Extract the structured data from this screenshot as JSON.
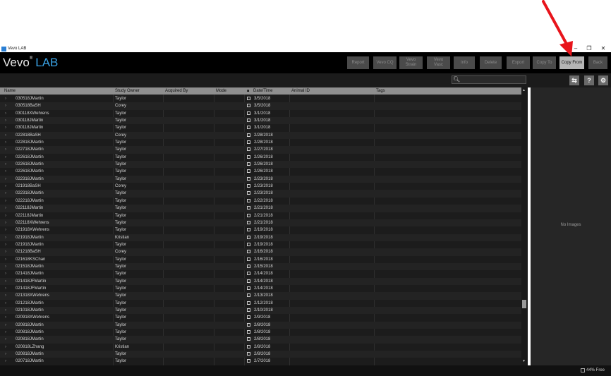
{
  "window": {
    "title": "Vevo LAB",
    "controls": {
      "minimize": "–",
      "maximize": "❐",
      "close": "✕"
    }
  },
  "logo": {
    "vevo": "Vevo",
    "reg": "®",
    "lab": "LAB"
  },
  "toolbar_buttons": [
    {
      "label": "Report",
      "active": false
    },
    {
      "label": "Vevo CQ",
      "active": false
    },
    {
      "label": "Vevo\nStrain",
      "active": false
    },
    {
      "label": "Vevo\nVasc",
      "active": false
    },
    {
      "label": "Info",
      "active": false
    },
    {
      "label": "Delete",
      "active": false
    },
    {
      "label": "Export",
      "active": false
    },
    {
      "label": "Copy To",
      "active": false
    },
    {
      "label": "Copy From",
      "active": true
    },
    {
      "label": "Back",
      "active": false
    }
  ],
  "search": {
    "placeholder": "",
    "icon": "search-icon"
  },
  "icon_buttons": [
    {
      "icon": "refresh-icon",
      "glyph": "⇆"
    },
    {
      "icon": "help-icon",
      "glyph": "?"
    },
    {
      "icon": "gear-icon",
      "glyph": "⚙"
    }
  ],
  "table": {
    "columns": [
      "Name",
      "Study Owner",
      "Acquired By",
      "Mode",
      "Date/Time",
      "Animal ID",
      "Tags"
    ],
    "lock_icon": "lock-icon",
    "rows": [
      {
        "name": "030518JMartin",
        "owner": "Taylor",
        "date": "3/5/2018"
      },
      {
        "name": "030518BaSH",
        "owner": "Corey",
        "date": "3/5/2018"
      },
      {
        "name": "030118XWehrens",
        "owner": "Taylor",
        "date": "3/1/2018"
      },
      {
        "name": "030118JMartin",
        "owner": "Taylor",
        "date": "3/1/2018"
      },
      {
        "name": "030118JMartin",
        "owner": "Taylor",
        "date": "3/1/2018"
      },
      {
        "name": "022818BaSH",
        "owner": "Corey",
        "date": "2/28/2018"
      },
      {
        "name": "022818JMartin",
        "owner": "Taylor",
        "date": "2/28/2018"
      },
      {
        "name": "022718JMartin",
        "owner": "Taylor",
        "date": "2/27/2018"
      },
      {
        "name": "022618JMartin",
        "owner": "Taylor",
        "date": "2/26/2018"
      },
      {
        "name": "022618JMartin",
        "owner": "Taylor",
        "date": "2/26/2018"
      },
      {
        "name": "022618JMartin",
        "owner": "Taylor",
        "date": "2/26/2018"
      },
      {
        "name": "022318JMartin",
        "owner": "Taylor",
        "date": "2/23/2018"
      },
      {
        "name": "021918BaSH",
        "owner": "Corey",
        "date": "2/23/2018"
      },
      {
        "name": "022318JMartin",
        "owner": "Taylor",
        "date": "2/23/2018"
      },
      {
        "name": "022218JMartin",
        "owner": "Taylor",
        "date": "2/22/2018"
      },
      {
        "name": "022118JMartin",
        "owner": "Taylor",
        "date": "2/21/2018"
      },
      {
        "name": "022118JMartin",
        "owner": "Taylor",
        "date": "2/21/2018"
      },
      {
        "name": "022118XWehrens",
        "owner": "Taylor",
        "date": "2/21/2018"
      },
      {
        "name": "021918XWehrens",
        "owner": "Taylor",
        "date": "2/19/2018"
      },
      {
        "name": "021918JMartin",
        "owner": "Kristian",
        "date": "2/19/2018"
      },
      {
        "name": "021918JMartin",
        "owner": "Taylor",
        "date": "2/19/2018"
      },
      {
        "name": "021218BaSH",
        "owner": "Corey",
        "date": "2/16/2018"
      },
      {
        "name": "021618KSChan",
        "owner": "Taylor",
        "date": "2/16/2018"
      },
      {
        "name": "021518JMartin",
        "owner": "Taylor",
        "date": "2/15/2018"
      },
      {
        "name": "021418JMartin",
        "owner": "Taylor",
        "date": "2/14/2018"
      },
      {
        "name": "021418JFMartin",
        "owner": "Taylor",
        "date": "2/14/2018"
      },
      {
        "name": "021418JFMartin",
        "owner": "Taylor",
        "date": "2/14/2018"
      },
      {
        "name": "021318XWehrens",
        "owner": "Taylor",
        "date": "2/13/2018"
      },
      {
        "name": "021218JMartin",
        "owner": "Taylor",
        "date": "2/12/2018"
      },
      {
        "name": "021018JMartin",
        "owner": "Taylor",
        "date": "2/10/2018"
      },
      {
        "name": "020918XWehrens",
        "owner": "Taylor",
        "date": "2/9/2018"
      },
      {
        "name": "020818JMartin",
        "owner": "Taylor",
        "date": "2/8/2018"
      },
      {
        "name": "020818JMartin",
        "owner": "Taylor",
        "date": "2/8/2018"
      },
      {
        "name": "020818JMartin",
        "owner": "Taylor",
        "date": "2/8/2018"
      },
      {
        "name": "020818LZhang",
        "owner": "Kristian",
        "date": "2/8/2018"
      },
      {
        "name": "020818JMartin",
        "owner": "Taylor",
        "date": "2/8/2018"
      },
      {
        "name": "020718JMartin",
        "owner": "Taylor",
        "date": "2/7/2018"
      }
    ]
  },
  "right_panel": {
    "empty_text": "No Images"
  },
  "status": {
    "disk_free": "44% Free",
    "disk_icon": "disk-icon"
  },
  "colors": {
    "accent": "#3aa3e6",
    "annotation_arrow": "#e8141b",
    "active_button": "#b5b5b5"
  }
}
